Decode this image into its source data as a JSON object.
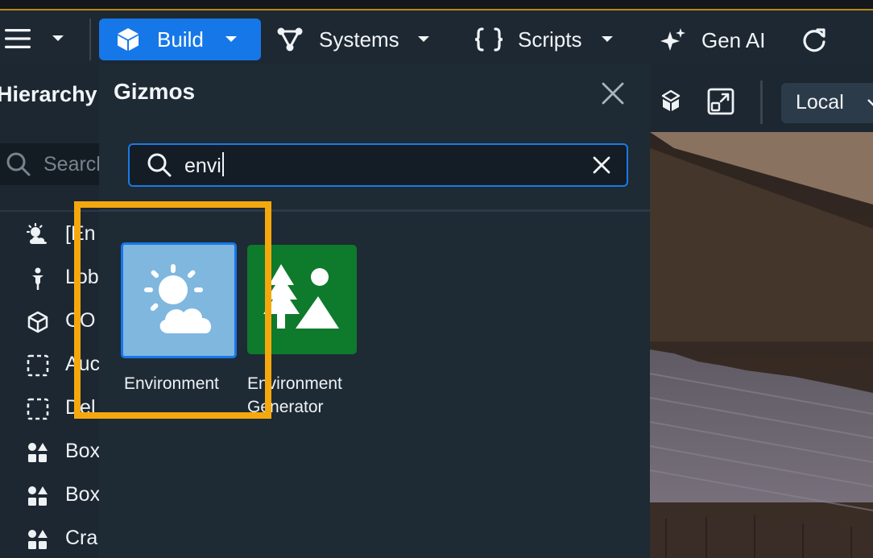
{
  "toolbar": {
    "build_label": "Build",
    "systems_label": "Systems",
    "scripts_label": "Scripts",
    "genai_label": "Gen AI"
  },
  "hierarchy": {
    "title": "Hierarchy",
    "search_placeholder": "Search",
    "items": [
      {
        "label": "[En",
        "icon": "weather-icon"
      },
      {
        "label": "Lob",
        "icon": "spawn-point-icon"
      },
      {
        "label": "CO",
        "icon": "cube-icon"
      },
      {
        "label": "Auc",
        "icon": "dashed-square-icon"
      },
      {
        "label": "Del",
        "icon": "dashed-square-icon"
      },
      {
        "label": "Box",
        "icon": "shapes-icon"
      },
      {
        "label": "Box",
        "icon": "shapes-icon"
      },
      {
        "label": "Cra",
        "icon": "shapes-icon"
      }
    ]
  },
  "viewport": {
    "space_label": "Local"
  },
  "gizmos": {
    "title": "Gizmos",
    "search_value": "envi",
    "results": [
      {
        "label": "Environment",
        "icon": "sun-cloud-icon",
        "color": "#7fb7df"
      },
      {
        "label": "Environment Generator",
        "icon": "landscape-icon",
        "color": "#0e7a2c"
      }
    ]
  },
  "colors": {
    "accent": "#1677e8",
    "highlight": "#f5a80e"
  }
}
